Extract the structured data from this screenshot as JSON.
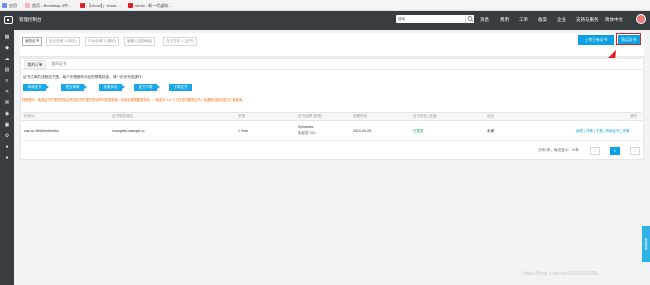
{
  "bookmarks": [
    {
      "label": "应用",
      "color": "#6b8de8"
    },
    {
      "label": "首页 - Bootstrap 3中...",
      "color": "#f8b8b8"
    },
    {
      "label": "【vhost】」vhost ...",
      "color": "#e02020"
    },
    {
      "label": "vhost - 新一代虚拟...",
      "color": "#e02020"
    }
  ],
  "topbar": {
    "title": "管理控制台",
    "search_placeholder": "搜索",
    "nav": [
      "消息",
      "费用",
      "工单",
      "备案",
      "企业",
      "支持与服务",
      "简体中文"
    ]
  },
  "sidebar_icons": [
    "grid-icon",
    "cube-icon",
    "cloud-icon",
    "database-icon",
    "list-icon",
    "tool-icon",
    "network-icon",
    "shield-icon",
    "chart-icon",
    "settings-icon",
    "circle-icon",
    "dot-icon"
  ],
  "page": {
    "tabs": [
      {
        "label": "我的证书",
        "active": true
      },
      {
        "label": "百元全域 3 (新区)",
        "active": false
      },
      {
        "label": "中台全域 1 (旗帜)",
        "active": false
      },
      {
        "label": "编辑 (法国地域)",
        "active": false
      },
      {
        "label": "百元华东 1 (证书)",
        "active": false
      }
    ],
    "upload_button": "上传已有证书",
    "buy_button": "购买证书"
  },
  "card": {
    "subtabs": [
      {
        "label": "我的订单",
        "active": true
      },
      {
        "label": "我的证书",
        "active": false
      }
    ],
    "guide": "证书订单的流程如下图，每个步骤都有对应的帮助信息，请一步步完成操作：",
    "steps": [
      "申请证书",
      "提交审核",
      "查看状态",
      "证书下载",
      "下载证书"
    ],
    "note": "特别提示：免费证书只需在购买后完成证书的提交申请即可完成安装，请务必按照要求完成，一般会在 1-2 个工作日内颁发证书；如遇到问题请提交工单咨询。"
  },
  "table": {
    "headers": [
      "实例ID",
      "证书绑定域名",
      "年限",
      "证书品牌 (类型)",
      "到期时间",
      "证书状态 (全部)",
      "状态",
      "操作"
    ],
    "rows": [
      {
        "id": "cas-cn-4560em6m6hu",
        "domain": "huangfeit.cataspsi.cc",
        "years": "1 Year",
        "brand": "Symantec",
        "brand_type": "免费型 SSL",
        "expire": "2019-09-28",
        "status": "已签发",
        "state": "未满",
        "actions": "续签 | 详情 | 下载 | 吊销证书 | 详情"
      }
    ]
  },
  "pagination": {
    "summary": "共有1条，每页显示：10条",
    "prev": "‹",
    "current": "1",
    "next": "›"
  },
  "float_button": "在线咨询",
  "watermark": "https://blog.csdn.net/h201627339...",
  "colors": {
    "topbar": "#373d41",
    "accent": "#0aa0e4",
    "highlight": "#e02020",
    "success": "#00a854",
    "warning": "#ff6600"
  }
}
